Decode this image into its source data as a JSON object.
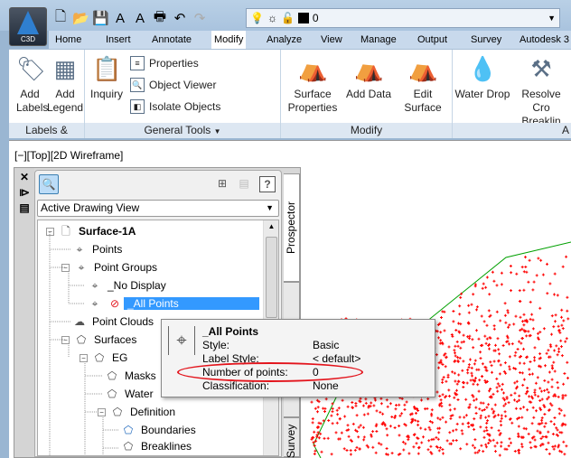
{
  "app": {
    "button_label": "C3D",
    "accent": "#2f7fd0"
  },
  "quick_access": {
    "icons": [
      "new-icon",
      "open-icon",
      "save-icon",
      "text-style-icon",
      "text-icon",
      "print-icon",
      "undo-icon",
      "redo-icon"
    ]
  },
  "layer_bar": {
    "layer_name": "0",
    "color": "#000000"
  },
  "tabs": [
    "Home",
    "Insert",
    "Annotate",
    "Modify",
    "Analyze",
    "View",
    "Manage",
    "Output",
    "Survey",
    "Autodesk 3"
  ],
  "ribbon": {
    "labels_tables": {
      "title": "Labels & Tables",
      "add_labels": "Add Labels",
      "add_legend": "Add Legend"
    },
    "general_tools": {
      "title": "General Tools",
      "inquiry": "Inquiry",
      "properties": "Properties",
      "object_viewer": "Object Viewer",
      "isolate_objects": "Isolate Objects"
    },
    "modify": {
      "title": "Modify",
      "surface_properties": "Surface Properties",
      "add_data": "Add Data",
      "edit_surface": "Edit Surface"
    },
    "analyze": {
      "title": "A",
      "water_drop": "Water Drop",
      "resolve": "Resolve Cro Breaklin"
    }
  },
  "viewport": {
    "label": "[−][Top][2D Wireframe]",
    "point_color": "#ff0000",
    "boundary_color": "#00a000"
  },
  "palette": {
    "view_select": "Active Drawing View",
    "tabs": [
      "Prospector",
      "s",
      "Survey"
    ],
    "tree": [
      {
        "label": "Surface-1A",
        "bold": true
      },
      {
        "label": "Points"
      },
      {
        "label": "Point Groups"
      },
      {
        "label": "_No Display"
      },
      {
        "label": "_All Points",
        "selected": true
      },
      {
        "label": "Point Clouds"
      },
      {
        "label": "Surfaces"
      },
      {
        "label": "EG"
      },
      {
        "label": "Masks"
      },
      {
        "label": "Water"
      },
      {
        "label": "Definition"
      },
      {
        "label": "Boundaries"
      },
      {
        "label": "Breaklines"
      }
    ]
  },
  "tooltip": {
    "title": "_All Points",
    "rows": [
      {
        "label": "Style:",
        "value": "Basic"
      },
      {
        "label": "Label Style:",
        "value": "< default>"
      },
      {
        "label": "Number of points:",
        "value": "0"
      },
      {
        "label": "Classification:",
        "value": "None"
      }
    ],
    "highlight_color": "#e3141c"
  }
}
